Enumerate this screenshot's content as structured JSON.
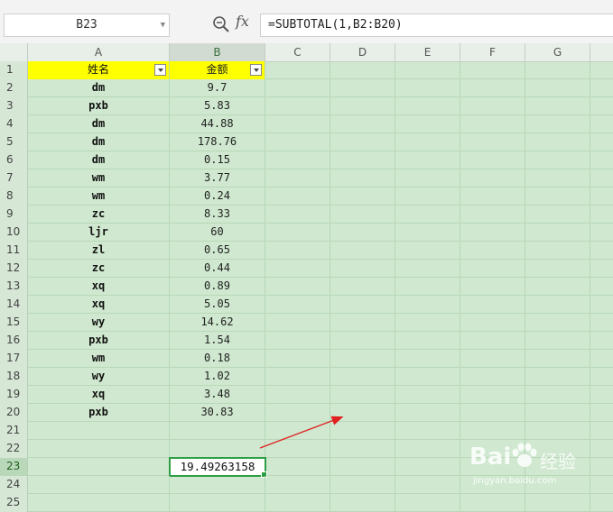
{
  "formula_bar": {
    "name_box": "B23",
    "fx_label": "fx",
    "formula": "=SUBTOTAL(1,B2:B20)"
  },
  "columns": [
    "A",
    "B",
    "C",
    "D",
    "E",
    "F",
    "G"
  ],
  "header_row": {
    "row": "1",
    "a": "姓名",
    "b": "金额"
  },
  "rows": [
    {
      "row": "2",
      "a": "dm",
      "b": "9.7"
    },
    {
      "row": "3",
      "a": "pxb",
      "b": "5.83"
    },
    {
      "row": "4",
      "a": "dm",
      "b": "44.88"
    },
    {
      "row": "5",
      "a": "dm",
      "b": "178.76"
    },
    {
      "row": "6",
      "a": "dm",
      "b": "0.15"
    },
    {
      "row": "7",
      "a": "wm",
      "b": "3.77"
    },
    {
      "row": "8",
      "a": "wm",
      "b": "0.24"
    },
    {
      "row": "9",
      "a": "zc",
      "b": "8.33"
    },
    {
      "row": "10",
      "a": "ljr",
      "b": "60"
    },
    {
      "row": "11",
      "a": "zl",
      "b": "0.65"
    },
    {
      "row": "12",
      "a": "zc",
      "b": "0.44"
    },
    {
      "row": "13",
      "a": "xq",
      "b": "0.89"
    },
    {
      "row": "14",
      "a": "xq",
      "b": "5.05"
    },
    {
      "row": "15",
      "a": "wy",
      "b": "14.62"
    },
    {
      "row": "16",
      "a": "pxb",
      "b": "1.54"
    },
    {
      "row": "17",
      "a": "wm",
      "b": "0.18"
    },
    {
      "row": "18",
      "a": "wy",
      "b": "1.02"
    },
    {
      "row": "19",
      "a": "xq",
      "b": "3.48"
    },
    {
      "row": "20",
      "a": "pxb",
      "b": "30.83"
    }
  ],
  "empty_rows": [
    "21",
    "22"
  ],
  "result_row": {
    "row": "23",
    "value": "19.49263158"
  },
  "trailing_rows": [
    "24",
    "25"
  ],
  "watermark": {
    "brand": "Bai",
    "text": "经验",
    "url": "jingyan.baidu.com"
  },
  "colors": {
    "selection": "#2e9e44",
    "header_fill": "#ffff00",
    "sheet_bg": "#cfe8cf",
    "annotation_arrow": "#e02020"
  }
}
